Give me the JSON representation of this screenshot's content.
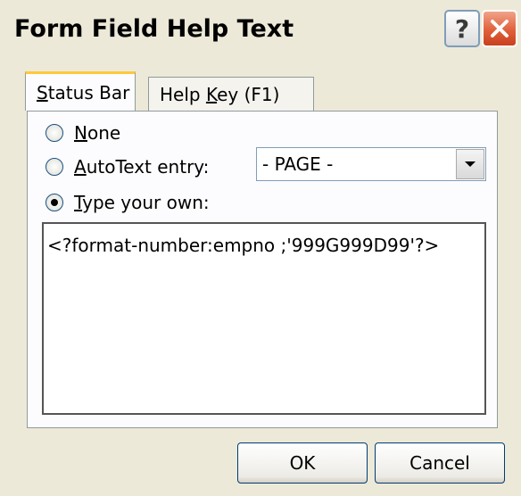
{
  "window": {
    "title": "Form Field Help Text"
  },
  "titlebar": {
    "help_glyph": "?",
    "close_glyph": "✕"
  },
  "tabs": [
    {
      "label_prefix": "",
      "mnemonic": "S",
      "label_suffix": "tatus Bar",
      "active": true
    },
    {
      "label_prefix": "Help ",
      "mnemonic": "K",
      "label_suffix": "ey (F1)",
      "active": false
    }
  ],
  "options": {
    "none": {
      "mnemonic": "N",
      "rest": "one",
      "checked": false
    },
    "autotext": {
      "mnemonic": "A",
      "rest": "utoText entry:",
      "checked": false
    },
    "type_own": {
      "mnemonic": "T",
      "rest": "ype your own:",
      "checked": true
    }
  },
  "autotext_combo": {
    "value": "- PAGE -"
  },
  "text_entry": {
    "value": "<?format-number:empno ;'999G999D99'?>"
  },
  "buttons": {
    "ok": "OK",
    "cancel": "Cancel"
  },
  "colors": {
    "tab_highlight": "#ffc83c",
    "close_button": "#e0603b",
    "dialog_bg": "#ece9d8"
  }
}
